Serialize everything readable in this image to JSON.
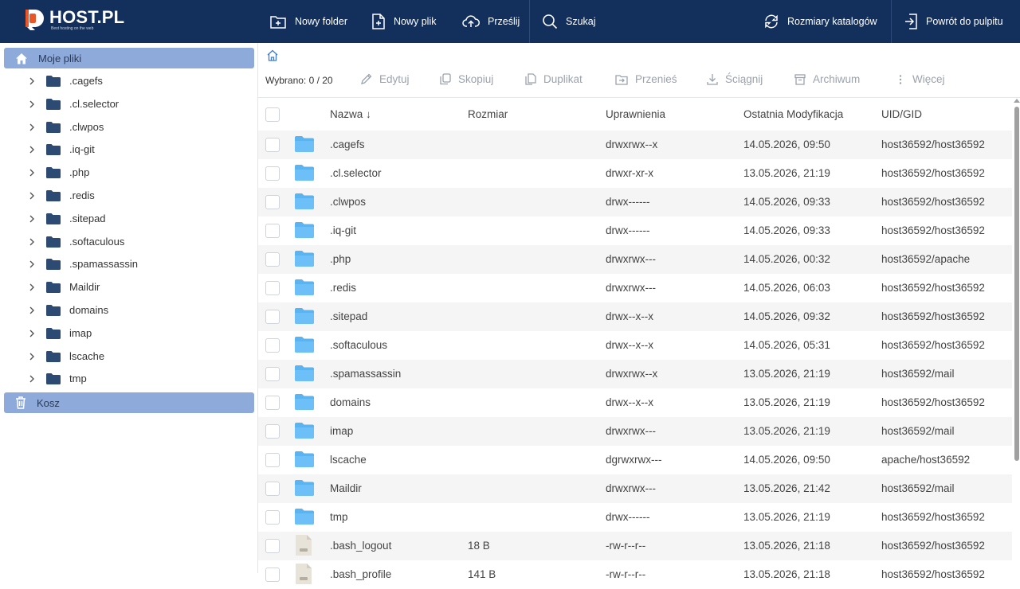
{
  "brand": {
    "name": "HOST.PL",
    "tagline": "Best hosting on the web"
  },
  "topbar": {
    "new_folder": "Nowy folder",
    "new_file": "Nowy plik",
    "upload": "Prześlij",
    "search": "Szukaj",
    "dir_sizes": "Rozmiary katalogów",
    "back": "Powrót do pulpitu"
  },
  "sidebar": {
    "root_label": "Moje pliki",
    "trash_label": "Kosz",
    "items": [
      ".cagefs",
      ".cl.selector",
      ".clwpos",
      ".iq-git",
      ".php",
      ".redis",
      ".sitepad",
      ".softaculous",
      ".spamassassin",
      "Maildir",
      "domains",
      "imap",
      "lscache",
      "tmp"
    ]
  },
  "toolbar": {
    "selected": "Wybrano: 0 / 20",
    "edit": "Edytuj",
    "copy": "Skopiuj",
    "duplicate": "Duplikat",
    "move": "Przenieś",
    "download": "Ściągnij",
    "archive": "Archiwum",
    "more": "Więcej"
  },
  "table": {
    "headers": {
      "name": "Nazwa ↓",
      "size": "Rozmiar",
      "perms": "Uprawnienia",
      "modified": "Ostatnia Modyfikacja",
      "uid": "UID/GID"
    },
    "rows": [
      {
        "type": "folder",
        "name": ".cagefs",
        "size": "",
        "perms": "drwxrwx--x",
        "modified": "14.05.2026, 09:50",
        "uid": "host36592/host36592"
      },
      {
        "type": "folder",
        "name": ".cl.selector",
        "size": "",
        "perms": "drwxr-xr-x",
        "modified": "13.05.2026, 21:19",
        "uid": "host36592/host36592"
      },
      {
        "type": "folder",
        "name": ".clwpos",
        "size": "",
        "perms": "drwx------",
        "modified": "14.05.2026, 09:33",
        "uid": "host36592/host36592"
      },
      {
        "type": "folder",
        "name": ".iq-git",
        "size": "",
        "perms": "drwx------",
        "modified": "14.05.2026, 09:33",
        "uid": "host36592/host36592"
      },
      {
        "type": "folder",
        "name": ".php",
        "size": "",
        "perms": "drwxrwx---",
        "modified": "14.05.2026, 00:32",
        "uid": "host36592/apache"
      },
      {
        "type": "folder",
        "name": ".redis",
        "size": "",
        "perms": "drwxrwx---",
        "modified": "14.05.2026, 06:03",
        "uid": "host36592/host36592"
      },
      {
        "type": "folder",
        "name": ".sitepad",
        "size": "",
        "perms": "drwx--x--x",
        "modified": "14.05.2026, 09:32",
        "uid": "host36592/host36592"
      },
      {
        "type": "folder",
        "name": ".softaculous",
        "size": "",
        "perms": "drwx--x--x",
        "modified": "14.05.2026, 05:31",
        "uid": "host36592/host36592"
      },
      {
        "type": "folder",
        "name": ".spamassassin",
        "size": "",
        "perms": "drwxrwx--x",
        "modified": "13.05.2026, 21:19",
        "uid": "host36592/mail"
      },
      {
        "type": "folder",
        "name": "domains",
        "size": "",
        "perms": "drwx--x--x",
        "modified": "13.05.2026, 21:19",
        "uid": "host36592/host36592"
      },
      {
        "type": "folder",
        "name": "imap",
        "size": "",
        "perms": "drwxrwx---",
        "modified": "13.05.2026, 21:19",
        "uid": "host36592/mail"
      },
      {
        "type": "folder",
        "name": "lscache",
        "size": "",
        "perms": "dgrwxrwx---",
        "modified": "14.05.2026, 09:50",
        "uid": "apache/host36592"
      },
      {
        "type": "folder",
        "name": "Maildir",
        "size": "",
        "perms": "drwxrwx---",
        "modified": "13.05.2026, 21:42",
        "uid": "host36592/mail"
      },
      {
        "type": "folder",
        "name": "tmp",
        "size": "",
        "perms": "drwx------",
        "modified": "13.05.2026, 21:19",
        "uid": "host36592/host36592"
      },
      {
        "type": "file",
        "name": ".bash_logout",
        "size": "18 B",
        "perms": "-rw-r--r--",
        "modified": "13.05.2026, 21:18",
        "uid": "host36592/host36592"
      },
      {
        "type": "file",
        "name": ".bash_profile",
        "size": "141 B",
        "perms": "-rw-r--r--",
        "modified": "13.05.2026, 21:18",
        "uid": "host36592/host36592"
      }
    ]
  },
  "colors": {
    "topbar": "#132f5c",
    "sidebar_active": "#8eaadb",
    "folder": "#5bb3f0",
    "accent": "#e8572a"
  }
}
